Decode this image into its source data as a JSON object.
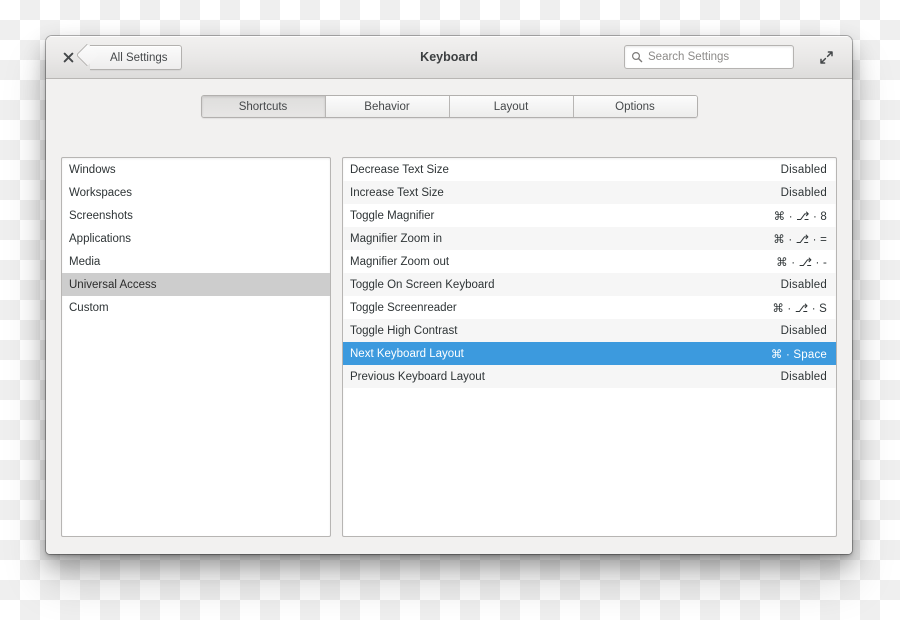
{
  "window": {
    "title": "Keyboard",
    "close_icon": "close-icon",
    "maximize_icon": "maximize-icon",
    "back_button_label": "All Settings",
    "search": {
      "placeholder": "Search Settings",
      "value": "",
      "icon": "search-icon"
    }
  },
  "tabs": [
    {
      "label": "Shortcuts",
      "active": true
    },
    {
      "label": "Behavior",
      "active": false
    },
    {
      "label": "Layout",
      "active": false
    },
    {
      "label": "Options",
      "active": false
    }
  ],
  "sidebar": {
    "items": [
      {
        "label": "Windows",
        "selected": false
      },
      {
        "label": "Workspaces",
        "selected": false
      },
      {
        "label": "Screenshots",
        "selected": false
      },
      {
        "label": "Applications",
        "selected": false
      },
      {
        "label": "Media",
        "selected": false
      },
      {
        "label": "Universal Access",
        "selected": true
      },
      {
        "label": "Custom",
        "selected": false
      }
    ]
  },
  "shortcuts": {
    "rows": [
      {
        "name": "Decrease Text Size",
        "accel": "Disabled",
        "selected": false
      },
      {
        "name": "Increase Text Size",
        "accel": "Disabled",
        "selected": false
      },
      {
        "name": "Toggle Magnifier",
        "accel": "⌘ · ⎇ · 8",
        "selected": false
      },
      {
        "name": "Magnifier Zoom in",
        "accel": "⌘ · ⎇ · =",
        "selected": false
      },
      {
        "name": "Magnifier Zoom out",
        "accel": "⌘ · ⎇ · -",
        "selected": false
      },
      {
        "name": "Toggle On Screen Keyboard",
        "accel": "Disabled",
        "selected": false
      },
      {
        "name": "Toggle Screenreader",
        "accel": "⌘ · ⎇ · S",
        "selected": false
      },
      {
        "name": "Toggle High Contrast",
        "accel": "Disabled",
        "selected": false
      },
      {
        "name": "Next Keyboard Layout",
        "accel": "⌘ · Space",
        "selected": true
      },
      {
        "name": "Previous Keyboard Layout",
        "accel": "Disabled",
        "selected": false
      }
    ]
  },
  "colors": {
    "selection_blue": "#3c9ade",
    "sidebar_selection_gray": "#cdcdcd",
    "window_chrome": "#f2f1f0",
    "row_alt": "#f6f6f6"
  }
}
